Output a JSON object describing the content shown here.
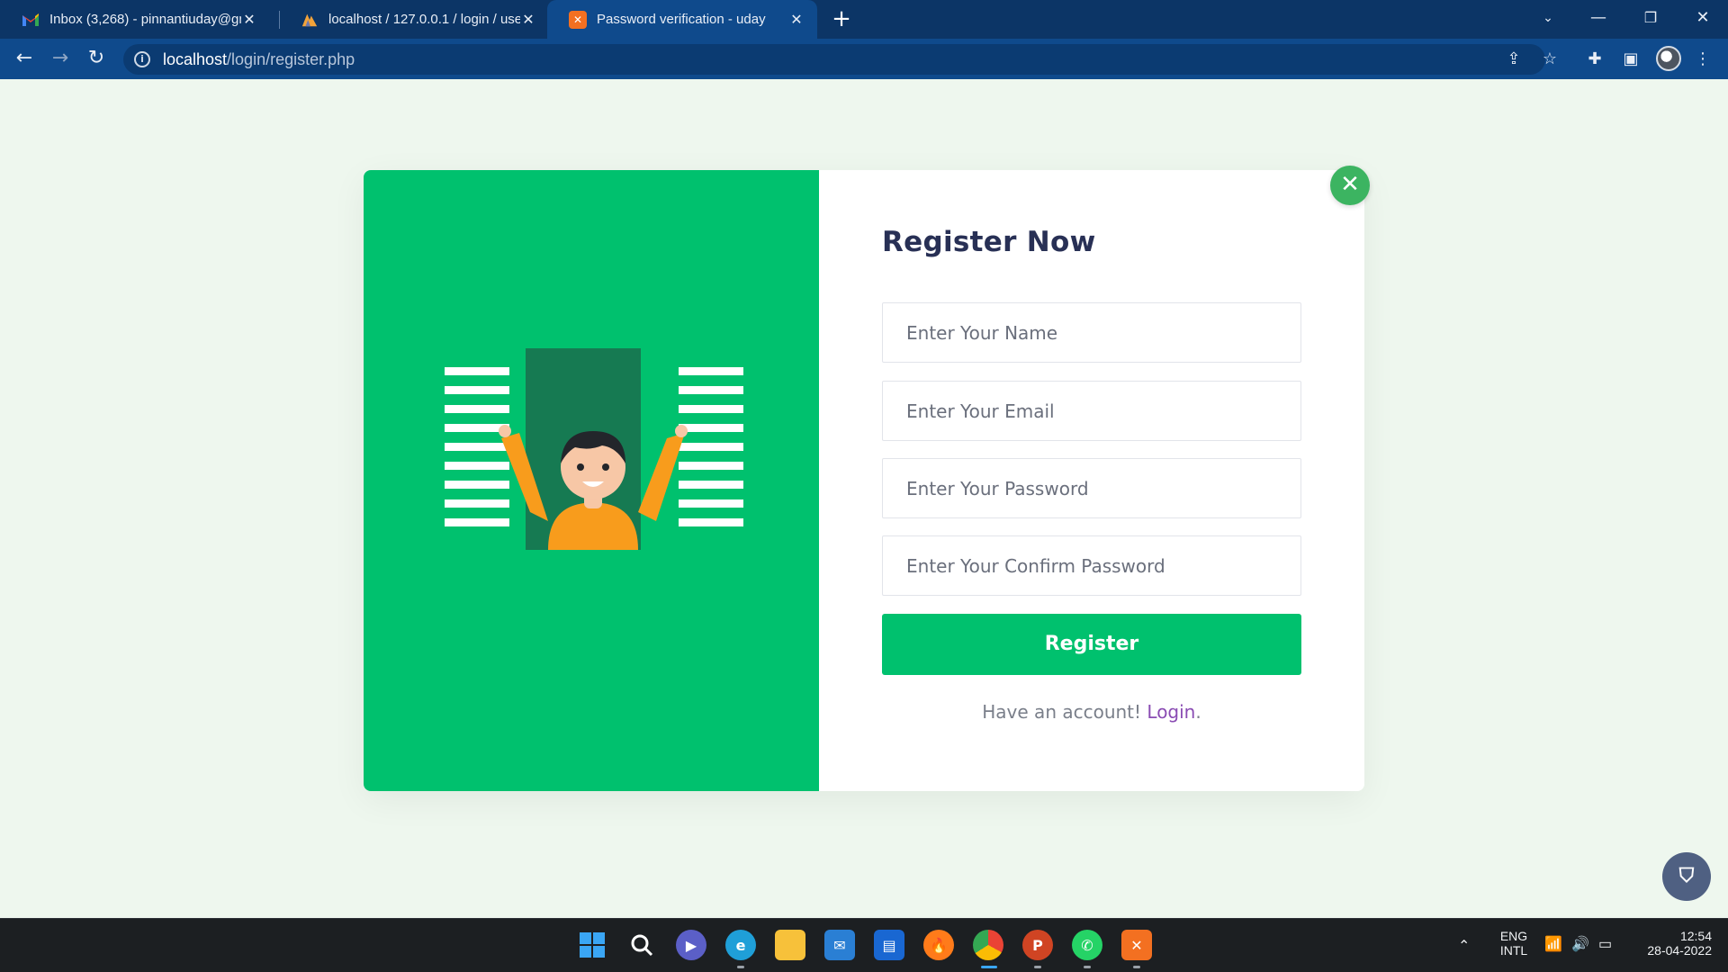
{
  "browser": {
    "tabs": [
      {
        "title": "Inbox (3,268) - pinnantiuday@gm",
        "favicon": "gmail-icon",
        "active": false
      },
      {
        "title": "localhost / 127.0.0.1 / login / user",
        "favicon": "phpmyadmin-icon",
        "active": false
      },
      {
        "title": "Password verification - uday",
        "favicon": "xampp-icon",
        "active": true
      }
    ],
    "url_host": "localhost",
    "url_path": "/login/register.php"
  },
  "form": {
    "title": "Register Now",
    "name_placeholder": "Enter Your Name",
    "email_placeholder": "Enter Your Email",
    "password_placeholder": "Enter Your Password",
    "confirm_placeholder": "Enter Your Confirm Password",
    "submit_label": "Register",
    "have_account_text": "Have an account!",
    "login_link": "Login",
    "period": "."
  },
  "colors": {
    "primary_green": "#00c16e",
    "title_navy": "#283055",
    "link_purple": "#8a4cb3",
    "browser_blue": "#0f4a8c"
  },
  "taskbar": {
    "lang_line1": "ENG",
    "lang_line2": "INTL",
    "time": "12:54",
    "date": "28-04-2022"
  }
}
